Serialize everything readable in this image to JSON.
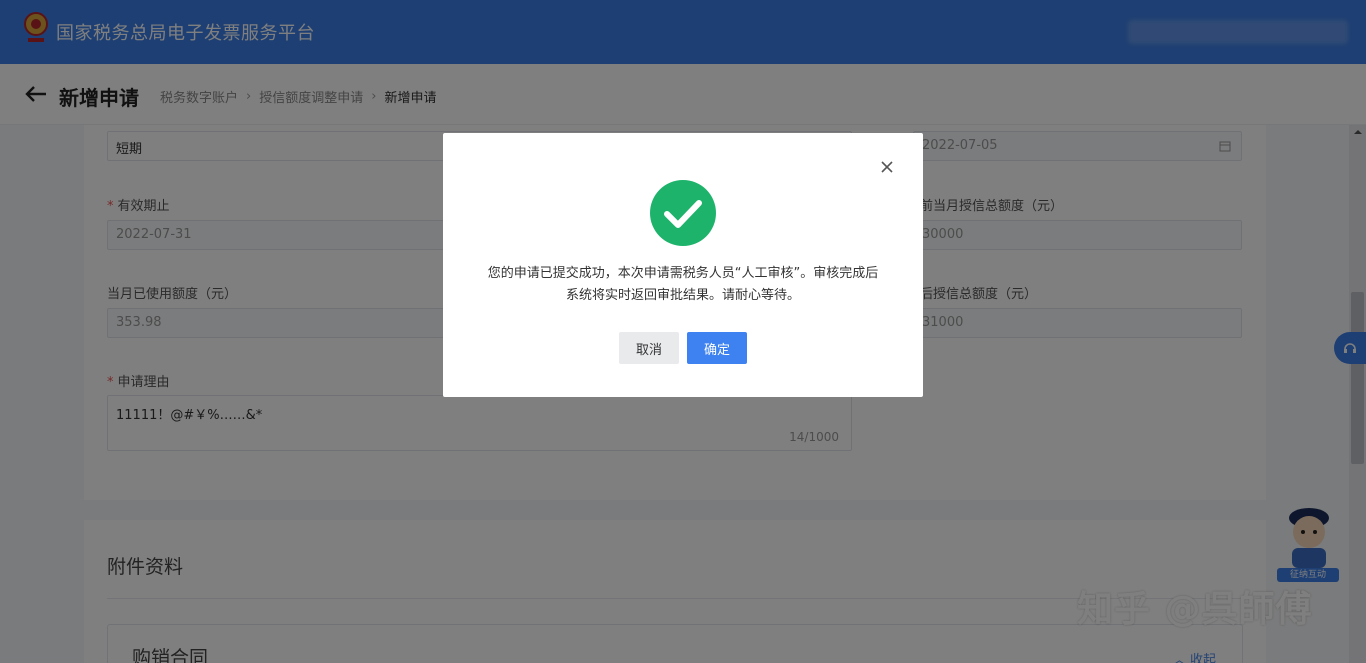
{
  "header": {
    "app_title": "国家税务总局电子发票服务平台"
  },
  "page": {
    "title": "新增申请",
    "breadcrumb": [
      "税务数字账户",
      "授信额度调整申请",
      "新增申请"
    ]
  },
  "form": {
    "term_value": "短期",
    "date_value_right": "2022-07-05",
    "valid_until_label": "有效期止",
    "valid_until_value": "2022-07-31",
    "current_total_label": "前当月授信总额度（元）",
    "current_total_value": "30000",
    "used_label": "当月已使用额度（元）",
    "used_value": "353.98",
    "after_total_label": "后授信总额度（元）",
    "after_total_value": "31000",
    "reason_label": "申请理由",
    "reason_value": "11111！@#￥%……&*",
    "reason_count": "14/1000"
  },
  "attachments": {
    "title": "附件资料",
    "contract_title": "购销合同",
    "collapse_label": "收起"
  },
  "mascot": {
    "label": "征纳互动"
  },
  "watermark": "知乎 @呉師傅",
  "dialog": {
    "message": "您的申请已提交成功，本次申请需税务人员“人工审核”。审核完成后系统将实时返回审批结果。请耐心等待。",
    "cancel_label": "取消",
    "ok_label": "确定"
  },
  "colors": {
    "primary": "#3d7ee6",
    "success": "#1db36b",
    "mask": "rgba(0,0,0,0.5)"
  }
}
